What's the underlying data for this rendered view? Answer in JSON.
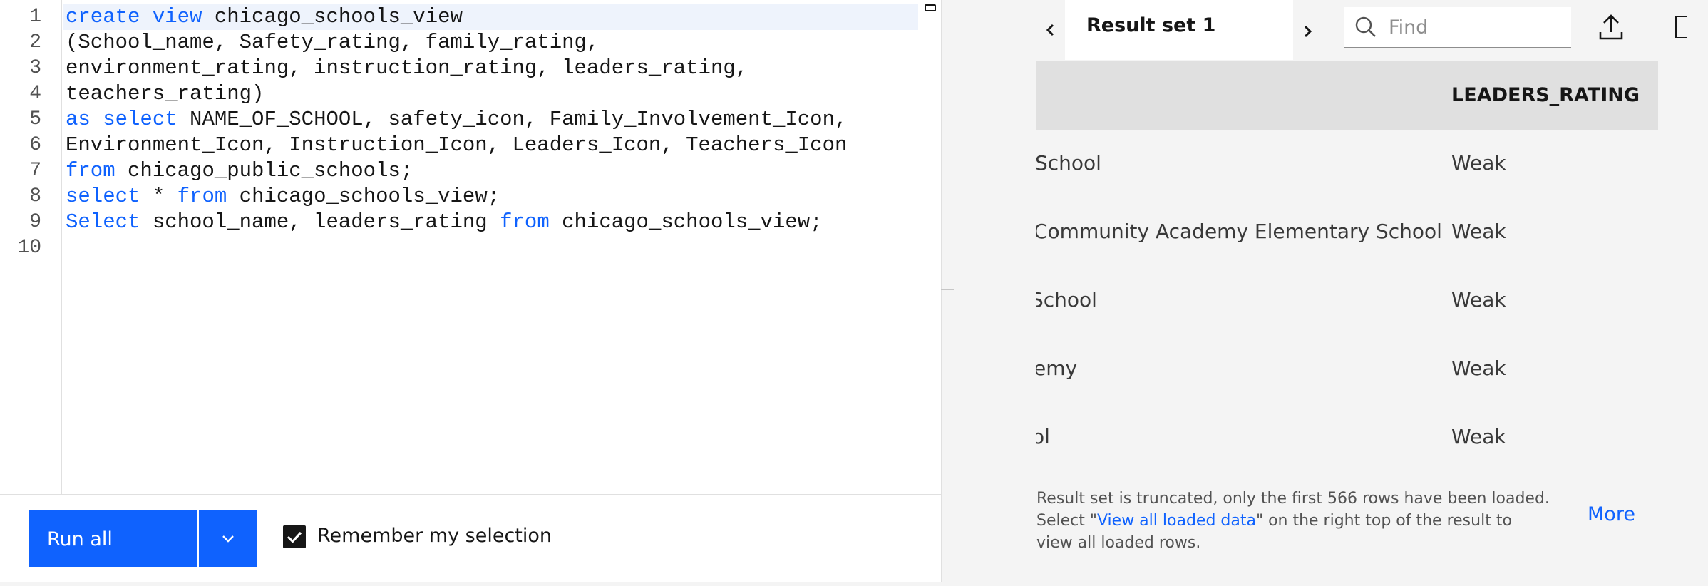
{
  "editor": {
    "line_numbers": [
      "1",
      "2",
      "3",
      "4",
      "5",
      "6",
      "7",
      "8",
      "9",
      "10"
    ],
    "lines": [
      {
        "kw1": "create view",
        "text": " chicago_schools_view"
      },
      {
        "text": "(School_name, Safety_rating, family_rating,"
      },
      {
        "text": "environment_rating, instruction_rating, leaders_rating,"
      },
      {
        "text": "teachers_rating)"
      },
      {
        "kw1": "as select",
        "text": " NAME_OF_SCHOOL, safety_icon, Family_Involvement_Icon,"
      },
      {
        "text": "Environment_Icon, Instruction_Icon, Leaders_Icon, Teachers_Icon"
      },
      {
        "kw1": "from",
        "text": " chicago_public_schools;"
      },
      {
        "kw1": "select",
        "mid": " * ",
        "kw2": "from",
        "text": " chicago_schools_view;"
      },
      {
        "kw1": "Select",
        "mid": " school_name, leaders_rating ",
        "kw2": "from",
        "text": " chicago_schools_view;"
      }
    ]
  },
  "runbar": {
    "run_all_label": "Run all",
    "dropdown_icon": "chevron-down-icon",
    "remember_label": "Remember my selection",
    "remember_checked": true
  },
  "results": {
    "tab_label": "Result set 1",
    "find_placeholder": "Find",
    "icons": {
      "prev": "chevron-left-icon",
      "next": "chevron-right-icon",
      "search": "search-icon",
      "export": "upload-icon"
    },
    "column_header": "LEADERS_RATING",
    "rows": [
      {
        "name": "School",
        "rating": "Weak"
      },
      {
        "name": "Community Academy Elementary School",
        "rating": "Weak"
      },
      {
        "name": " School",
        "rating": "Weak"
      },
      {
        "name": "emy",
        "rating": "Weak"
      },
      {
        "name": "ol",
        "rating": "Weak"
      }
    ],
    "note": {
      "part1": "Result set is truncated, only the first 566 rows have been loaded. Select \"",
      "link": "View all loaded data",
      "part2": "\" on the right top of the result to view all loaded rows."
    },
    "more_label": "More"
  },
  "colors": {
    "accent": "#0f62fe",
    "panel_bg": "#f4f4f4",
    "header_bg": "#e0e0e0"
  }
}
